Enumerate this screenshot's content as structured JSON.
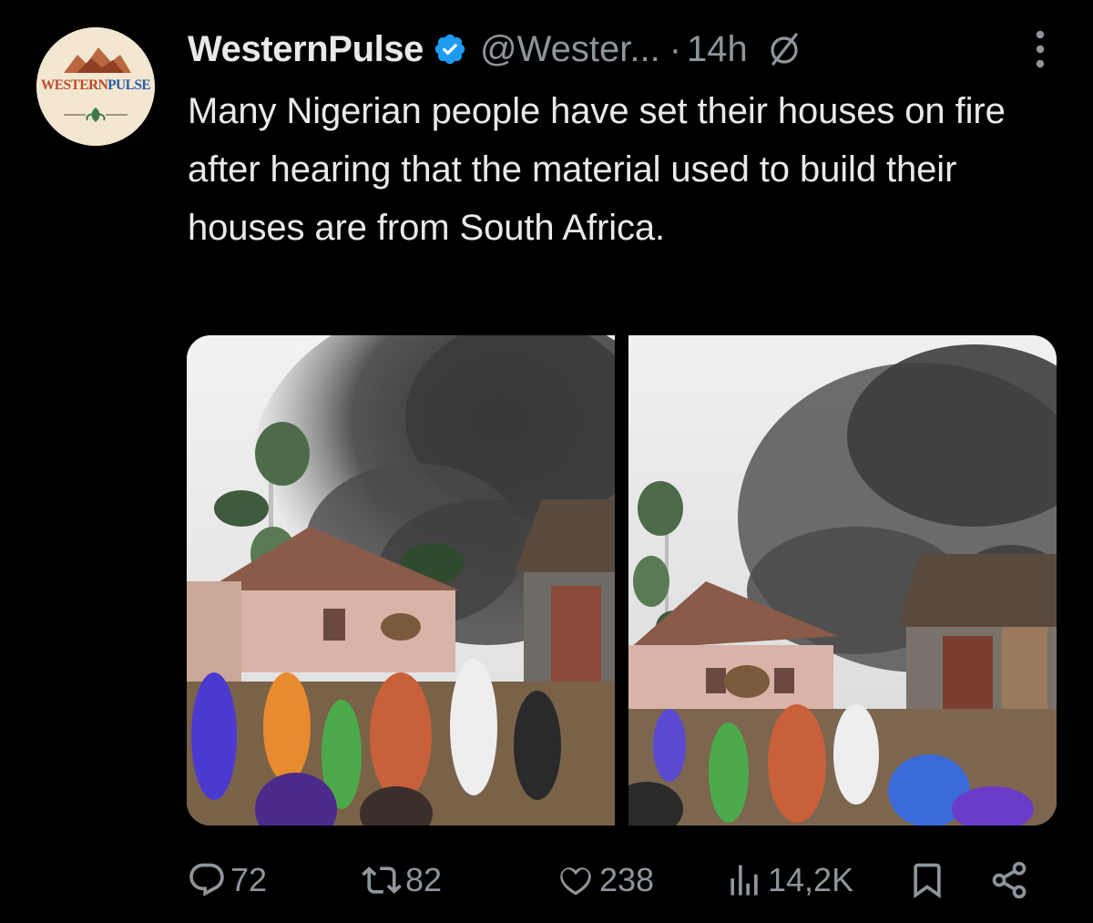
{
  "account": {
    "display_name": "WesternPulse",
    "handle": "@Wester...",
    "separator": "·",
    "time": "14h",
    "avatar_text_1": "WESTERN",
    "avatar_text_2": "PULSE",
    "verified": true
  },
  "tweet": {
    "text": "Many Nigerian people have set their houses on fire after hearing that the material used to build their houses are from South Africa."
  },
  "media": {
    "photos": [
      {
        "id": "photo-1",
        "icon": "image"
      },
      {
        "id": "photo-2",
        "icon": "image"
      }
    ]
  },
  "actions": {
    "replies": "72",
    "reposts": "82",
    "likes": "238",
    "views": "14,2K"
  },
  "icons": {
    "verified": "verified-badge-icon",
    "grok": "grok-icon",
    "more": "more-options-icon",
    "reply": "reply-icon",
    "repost": "repost-icon",
    "like": "heart-icon",
    "views": "views-icon",
    "bookmark": "bookmark-icon",
    "share": "share-icon"
  },
  "colors": {
    "background": "#000000",
    "text": "#e7e9ea",
    "secondary": "#8f959a",
    "verified": "#1d9bf0"
  }
}
